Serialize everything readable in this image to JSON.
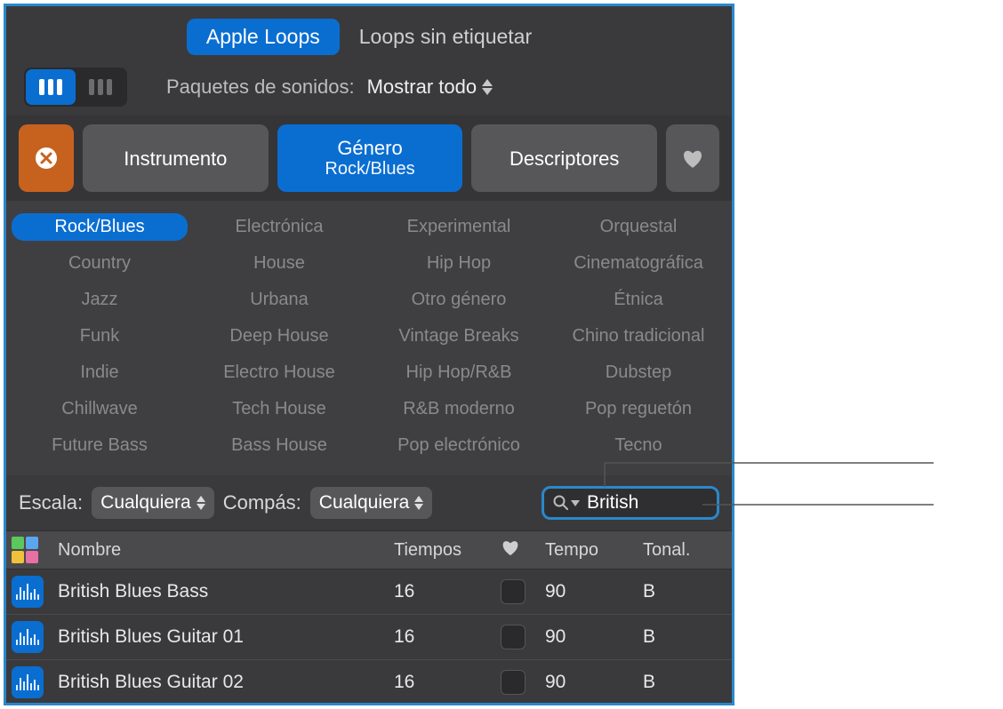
{
  "tabs": {
    "apple_loops": "Apple Loops",
    "untagged": "Loops sin etiquetar"
  },
  "packs": {
    "label": "Paquetes de sonidos:",
    "value": "Mostrar todo"
  },
  "filters": {
    "instrument": "Instrumento",
    "genre_label": "Género",
    "genre_value": "Rock/Blues",
    "descriptors": "Descriptores"
  },
  "genres": {
    "c0": [
      "Rock/Blues",
      "Country",
      "Jazz",
      "Funk",
      "Indie",
      "Chillwave",
      "Future Bass"
    ],
    "c1": [
      "Electrónica",
      "House",
      "Urbana",
      "Deep House",
      "Electro House",
      "Tech House",
      "Bass House"
    ],
    "c2": [
      "Experimental",
      "Hip Hop",
      "Otro género",
      "Vintage Breaks",
      "Hip Hop/R&B",
      "R&B moderno",
      "Pop electrónico"
    ],
    "c3": [
      "Orquestal",
      "Cinematográfica",
      "Étnica",
      "Chino tradicional",
      "Dubstep",
      "Pop reguetón",
      "Tecno"
    ]
  },
  "controls": {
    "scale_label": "Escala:",
    "scale_value": "Cualquiera",
    "sig_label": "Compás:",
    "sig_value": "Cualquiera",
    "search_value": "British"
  },
  "columns": {
    "name": "Nombre",
    "beats": "Tiempos",
    "tempo": "Tempo",
    "key": "Tonal."
  },
  "rows": [
    {
      "name": "British Blues Bass",
      "beats": "16",
      "tempo": "90",
      "key": "B"
    },
    {
      "name": "British Blues Guitar 01",
      "beats": "16",
      "tempo": "90",
      "key": "B"
    },
    {
      "name": "British Blues Guitar 02",
      "beats": "16",
      "tempo": "90",
      "key": "B"
    }
  ]
}
